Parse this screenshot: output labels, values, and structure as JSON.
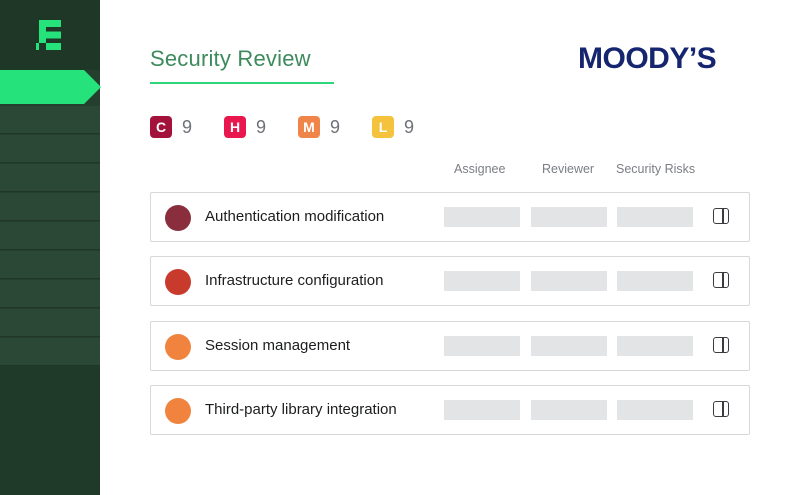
{
  "header": {
    "title": "Security Review",
    "brand": "MOODY’S"
  },
  "sidebar": {
    "logo_icon": "app-logo-icon",
    "accent_color": "#25e27a",
    "active_item_index": 0,
    "item_count": 9
  },
  "severity": [
    {
      "letter": "C",
      "count": "9",
      "color": "#a2123a"
    },
    {
      "letter": "H",
      "count": "9",
      "color": "#e8174e"
    },
    {
      "letter": "M",
      "count": "9",
      "color": "#f0854a"
    },
    {
      "letter": "L",
      "count": "9",
      "color": "#f4c23c"
    }
  ],
  "columns": {
    "assignee": "Assignee",
    "reviewer": "Reviewer",
    "risks": "Security Risks"
  },
  "rows": [
    {
      "label": "Authentication modification",
      "severity_color": "#8a2e3e",
      "action_icon": "side-panel-icon"
    },
    {
      "label": "Infrastructure configuration",
      "severity_color": "#c83a2c",
      "action_icon": "side-panel-icon"
    },
    {
      "label": "Session management",
      "severity_color": "#f0843f",
      "action_icon": "side-panel-icon"
    },
    {
      "label": "Third-party library integration",
      "severity_color": "#f0843f",
      "action_icon": "side-panel-icon"
    }
  ]
}
